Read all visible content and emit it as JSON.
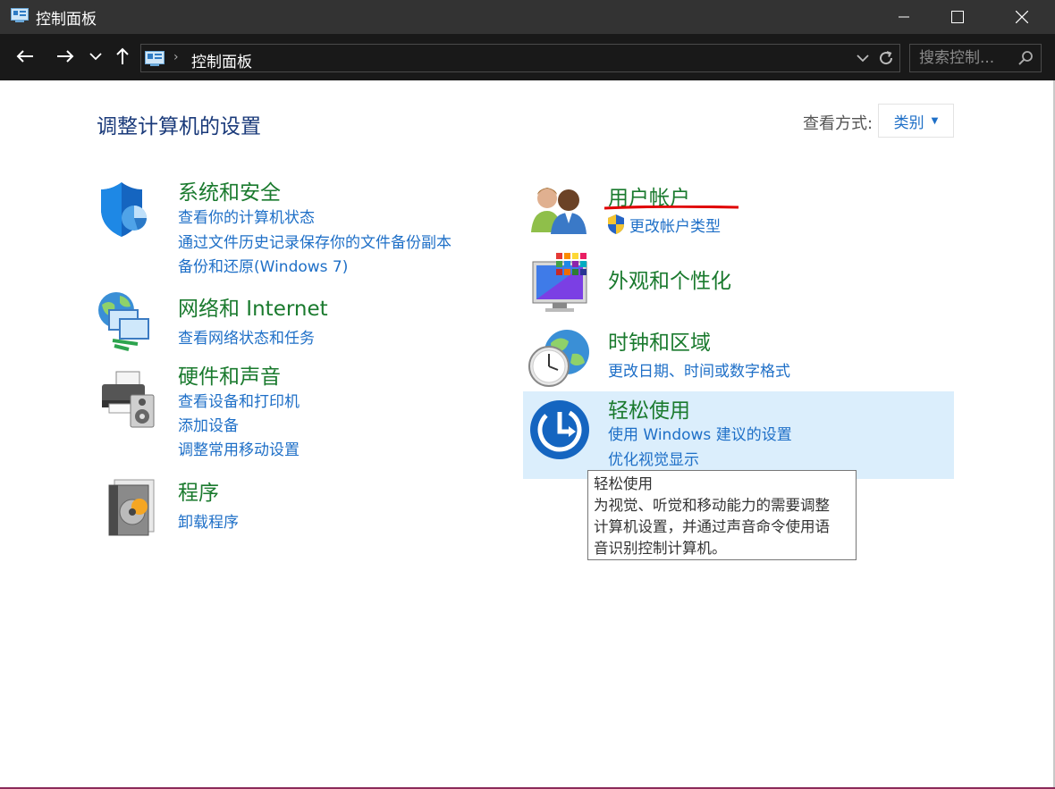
{
  "window": {
    "title": "控制面板"
  },
  "address_bar": {
    "path": "控制面板"
  },
  "search": {
    "placeholder": "搜索控制..."
  },
  "header": {
    "title": "调整计算机的设置",
    "view_by_label": "查看方式:",
    "view_by_value": "类别"
  },
  "categories": {
    "system_security": {
      "heading": "系统和安全",
      "links": [
        "查看你的计算机状态",
        "通过文件历史记录保存你的文件备份副本",
        "备份和还原(Windows 7)"
      ],
      "icon": "shield-icon"
    },
    "network": {
      "heading": "网络和 Internet",
      "links": [
        "查看网络状态和任务"
      ],
      "icon": "network-icon"
    },
    "hardware": {
      "heading": "硬件和声音",
      "links": [
        "查看设备和打印机",
        "添加设备",
        "调整常用移动设置"
      ],
      "icon": "printer-icon"
    },
    "programs": {
      "heading": "程序",
      "links": [
        "卸载程序"
      ],
      "icon": "programs-icon"
    },
    "user_accounts": {
      "heading": "用户帐户",
      "links": [
        "更改帐户类型"
      ],
      "icon": "users-icon"
    },
    "appearance": {
      "heading": "外观和个性化",
      "links": [],
      "icon": "appearance-icon"
    },
    "clock_region": {
      "heading": "时钟和区域",
      "links": [
        "更改日期、时间或数字格式"
      ],
      "icon": "clock-globe-icon"
    },
    "ease_of_access": {
      "heading": "轻松使用",
      "links": [
        "使用 Windows 建议的设置",
        "优化视觉显示"
      ],
      "icon": "ease-of-access-icon"
    }
  },
  "tooltip": {
    "title": "轻松使用",
    "lines": [
      "为视觉、听觉和移动能力的需要调整",
      "计算机设置，并通过声音命令使用语",
      "音识别控制计算机。"
    ]
  },
  "colors": {
    "heading_green": "#1a7a2e",
    "link_blue": "#1e6fc7",
    "title_navy": "#1a3a7a",
    "highlight": "#dbeefc",
    "annotation_red": "#e00000"
  }
}
